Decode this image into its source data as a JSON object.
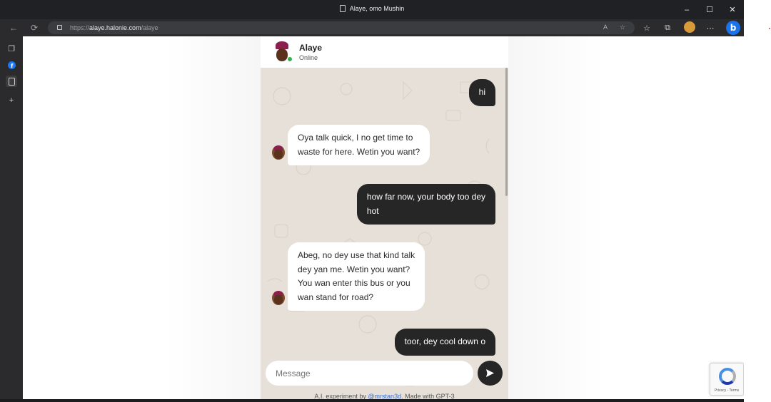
{
  "window": {
    "title": "Alaye, omo Mushin",
    "controls": {
      "minimize": "–",
      "maximize": "☐",
      "close": "✕"
    }
  },
  "browser": {
    "url_protocol": "https://",
    "url_domain": "alaye.halonie.com",
    "url_path": "/alaye",
    "read_aloud": "A",
    "bing_label": "b"
  },
  "chat": {
    "contact_name": "Alaye",
    "contact_status": "Online",
    "messages": [
      {
        "from": "user",
        "text": "hi"
      },
      {
        "from": "bot",
        "text": "Oya talk quick, I no get time to\nwaste for here. Wetin you want?"
      },
      {
        "from": "user",
        "text": "how far now, your body too dey\nhot"
      },
      {
        "from": "bot",
        "text": "Abeg, no dey use that kind talk\ndey yan me. Wetin you want?\nYou wan enter this bus or you\nwan stand for road?"
      },
      {
        "from": "user",
        "text": "toor, dey cool down o"
      }
    ],
    "input_placeholder": "Message",
    "footer_prefix": "A.I. experiment by ",
    "footer_link": "@mrstan3d",
    "footer_suffix": ". Made with GPT-3"
  },
  "recaptcha": {
    "terms": "Privacy - Terms"
  },
  "colors": {
    "chat_background": "#e6e0d8",
    "bubble_out": "#262626",
    "bubble_in": "#ffffff",
    "online": "#2fb34a",
    "avatar_cap": "#8c1d4f",
    "bing_blue": "#1a73e8"
  },
  "icons": [
    "page-icon",
    "back-icon",
    "refresh-icon",
    "lock-icon",
    "read-aloud-icon",
    "add-favorite-icon",
    "favorites-icon",
    "collections-icon",
    "profile-icon",
    "more-icon",
    "bing-icon",
    "tab-actions-icon",
    "facebook-icon",
    "page-tab-icon",
    "new-tab-icon",
    "send-icon",
    "recaptcha-icon"
  ]
}
